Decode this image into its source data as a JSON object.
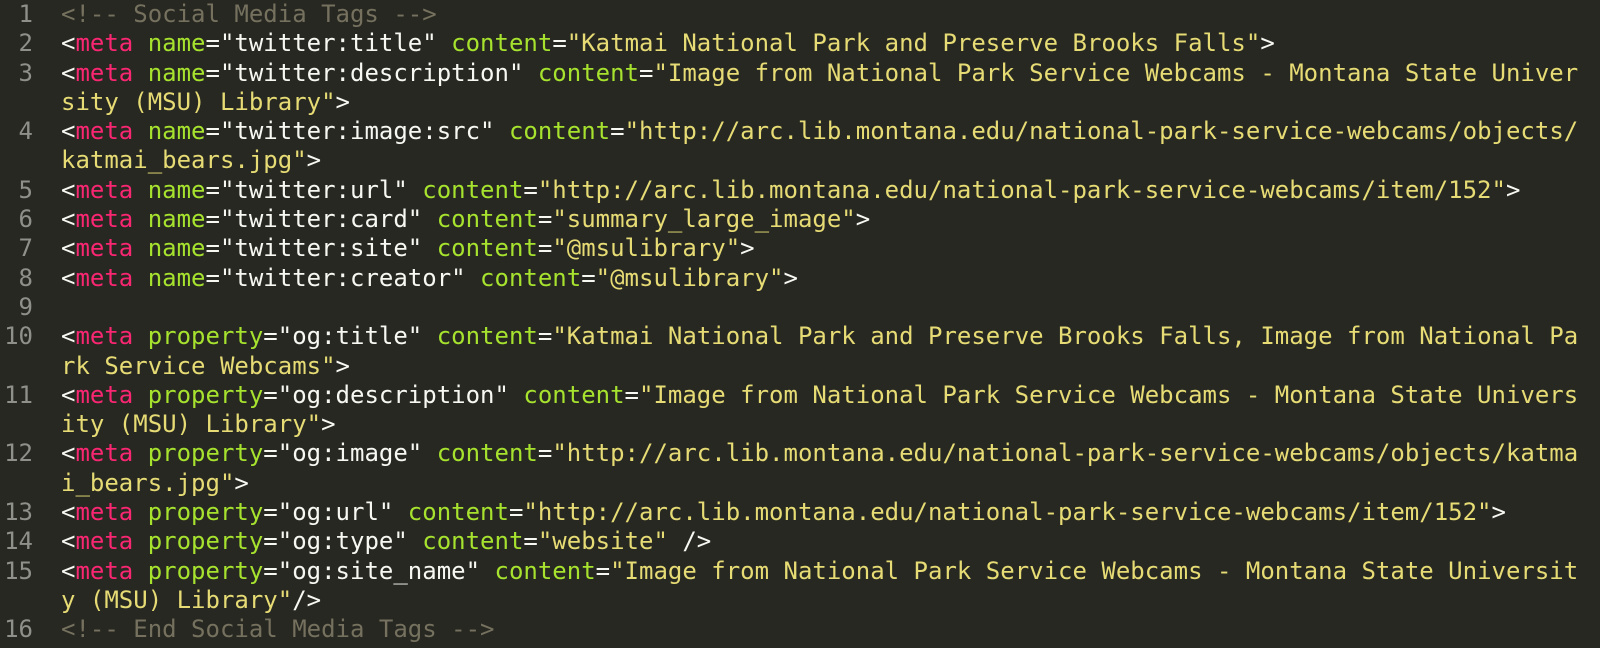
{
  "theme": {
    "background": "#272822",
    "text": "#f8f8f2",
    "gutter": "#90908a",
    "comment": "#75715e",
    "tag": "#f92672",
    "attribute": "#a6e22e",
    "string": "#e6db74"
  },
  "lines": [
    {
      "num": "1",
      "tokens": [
        {
          "t": "comment",
          "v": "<!-- Social Media Tags -->"
        }
      ]
    },
    {
      "num": "2",
      "tokens": [
        {
          "t": "punct",
          "v": "<"
        },
        {
          "t": "tag",
          "v": "meta"
        },
        {
          "t": "punct",
          "v": " "
        },
        {
          "t": "attr",
          "v": "name"
        },
        {
          "t": "punct",
          "v": "="
        },
        {
          "t": "punct",
          "v": "\"twitter:title\""
        },
        {
          "t": "punct",
          "v": " "
        },
        {
          "t": "attr",
          "v": "content"
        },
        {
          "t": "punct",
          "v": "="
        },
        {
          "t": "string",
          "v": "\"Katmai National Park and Preserve Brooks Falls\""
        },
        {
          "t": "punct",
          "v": ">"
        }
      ]
    },
    {
      "num": "3",
      "tokens": [
        {
          "t": "punct",
          "v": "<"
        },
        {
          "t": "tag",
          "v": "meta"
        },
        {
          "t": "punct",
          "v": " "
        },
        {
          "t": "attr",
          "v": "name"
        },
        {
          "t": "punct",
          "v": "="
        },
        {
          "t": "punct",
          "v": "\"twitter:description\""
        },
        {
          "t": "punct",
          "v": " "
        },
        {
          "t": "attr",
          "v": "content"
        },
        {
          "t": "punct",
          "v": "="
        },
        {
          "t": "string",
          "v": "\"Image from National Park Service Webcams - Montana State University (MSU) Library\""
        },
        {
          "t": "punct",
          "v": ">"
        }
      ]
    },
    {
      "num": "4",
      "tokens": [
        {
          "t": "punct",
          "v": "<"
        },
        {
          "t": "tag",
          "v": "meta"
        },
        {
          "t": "punct",
          "v": " "
        },
        {
          "t": "attr",
          "v": "name"
        },
        {
          "t": "punct",
          "v": "="
        },
        {
          "t": "punct",
          "v": "\"twitter:image:src\""
        },
        {
          "t": "punct",
          "v": " "
        },
        {
          "t": "attr",
          "v": "content"
        },
        {
          "t": "punct",
          "v": "="
        },
        {
          "t": "string",
          "v": "\"http://arc.lib.montana.edu/national-park-service-webcams/objects/katmai_bears.jpg\""
        },
        {
          "t": "punct",
          "v": ">"
        }
      ]
    },
    {
      "num": "5",
      "tokens": [
        {
          "t": "punct",
          "v": "<"
        },
        {
          "t": "tag",
          "v": "meta"
        },
        {
          "t": "punct",
          "v": " "
        },
        {
          "t": "attr",
          "v": "name"
        },
        {
          "t": "punct",
          "v": "="
        },
        {
          "t": "punct",
          "v": "\"twitter:url\""
        },
        {
          "t": "punct",
          "v": " "
        },
        {
          "t": "attr",
          "v": "content"
        },
        {
          "t": "punct",
          "v": "="
        },
        {
          "t": "string",
          "v": "\"http://arc.lib.montana.edu/national-park-service-webcams/item/152\""
        },
        {
          "t": "punct",
          "v": ">"
        }
      ]
    },
    {
      "num": "6",
      "tokens": [
        {
          "t": "punct",
          "v": "<"
        },
        {
          "t": "tag",
          "v": "meta"
        },
        {
          "t": "punct",
          "v": " "
        },
        {
          "t": "attr",
          "v": "name"
        },
        {
          "t": "punct",
          "v": "="
        },
        {
          "t": "punct",
          "v": "\"twitter:card\""
        },
        {
          "t": "punct",
          "v": " "
        },
        {
          "t": "attr",
          "v": "content"
        },
        {
          "t": "punct",
          "v": "="
        },
        {
          "t": "string",
          "v": "\"summary_large_image\""
        },
        {
          "t": "punct",
          "v": ">"
        }
      ]
    },
    {
      "num": "7",
      "tokens": [
        {
          "t": "punct",
          "v": "<"
        },
        {
          "t": "tag",
          "v": "meta"
        },
        {
          "t": "punct",
          "v": " "
        },
        {
          "t": "attr",
          "v": "name"
        },
        {
          "t": "punct",
          "v": "="
        },
        {
          "t": "punct",
          "v": "\"twitter:site\""
        },
        {
          "t": "punct",
          "v": " "
        },
        {
          "t": "attr",
          "v": "content"
        },
        {
          "t": "punct",
          "v": "="
        },
        {
          "t": "string",
          "v": "\"@msulibrary\""
        },
        {
          "t": "punct",
          "v": ">"
        }
      ]
    },
    {
      "num": "8",
      "tokens": [
        {
          "t": "punct",
          "v": "<"
        },
        {
          "t": "tag",
          "v": "meta"
        },
        {
          "t": "punct",
          "v": " "
        },
        {
          "t": "attr",
          "v": "name"
        },
        {
          "t": "punct",
          "v": "="
        },
        {
          "t": "punct",
          "v": "\"twitter:creator\""
        },
        {
          "t": "punct",
          "v": " "
        },
        {
          "t": "attr",
          "v": "content"
        },
        {
          "t": "punct",
          "v": "="
        },
        {
          "t": "string",
          "v": "\"@msulibrary\""
        },
        {
          "t": "punct",
          "v": ">"
        }
      ]
    },
    {
      "num": "9",
      "tokens": []
    },
    {
      "num": "10",
      "tokens": [
        {
          "t": "punct",
          "v": "<"
        },
        {
          "t": "tag",
          "v": "meta"
        },
        {
          "t": "punct",
          "v": " "
        },
        {
          "t": "attr",
          "v": "property"
        },
        {
          "t": "punct",
          "v": "="
        },
        {
          "t": "punct",
          "v": "\"og:title\""
        },
        {
          "t": "punct",
          "v": " "
        },
        {
          "t": "attr",
          "v": "content"
        },
        {
          "t": "punct",
          "v": "="
        },
        {
          "t": "string",
          "v": "\"Katmai National Park and Preserve Brooks Falls, Image from National Park Service Webcams\""
        },
        {
          "t": "punct",
          "v": ">"
        }
      ]
    },
    {
      "num": "11",
      "tokens": [
        {
          "t": "punct",
          "v": "<"
        },
        {
          "t": "tag",
          "v": "meta"
        },
        {
          "t": "punct",
          "v": " "
        },
        {
          "t": "attr",
          "v": "property"
        },
        {
          "t": "punct",
          "v": "="
        },
        {
          "t": "punct",
          "v": "\"og:description\""
        },
        {
          "t": "punct",
          "v": " "
        },
        {
          "t": "attr",
          "v": "content"
        },
        {
          "t": "punct",
          "v": "="
        },
        {
          "t": "string",
          "v": "\"Image from National Park Service Webcams - Montana State University (MSU) Library\""
        },
        {
          "t": "punct",
          "v": ">"
        }
      ]
    },
    {
      "num": "12",
      "tokens": [
        {
          "t": "punct",
          "v": "<"
        },
        {
          "t": "tag",
          "v": "meta"
        },
        {
          "t": "punct",
          "v": " "
        },
        {
          "t": "attr",
          "v": "property"
        },
        {
          "t": "punct",
          "v": "="
        },
        {
          "t": "punct",
          "v": "\"og:image\""
        },
        {
          "t": "punct",
          "v": " "
        },
        {
          "t": "attr",
          "v": "content"
        },
        {
          "t": "punct",
          "v": "="
        },
        {
          "t": "string",
          "v": "\"http://arc.lib.montana.edu/national-park-service-webcams/objects/katmai_bears.jpg\""
        },
        {
          "t": "punct",
          "v": ">"
        }
      ]
    },
    {
      "num": "13",
      "tokens": [
        {
          "t": "punct",
          "v": "<"
        },
        {
          "t": "tag",
          "v": "meta"
        },
        {
          "t": "punct",
          "v": " "
        },
        {
          "t": "attr",
          "v": "property"
        },
        {
          "t": "punct",
          "v": "="
        },
        {
          "t": "punct",
          "v": "\"og:url\""
        },
        {
          "t": "punct",
          "v": " "
        },
        {
          "t": "attr",
          "v": "content"
        },
        {
          "t": "punct",
          "v": "="
        },
        {
          "t": "string",
          "v": "\"http://arc.lib.montana.edu/national-park-service-webcams/item/152\""
        },
        {
          "t": "punct",
          "v": ">"
        }
      ]
    },
    {
      "num": "14",
      "tokens": [
        {
          "t": "punct",
          "v": "<"
        },
        {
          "t": "tag",
          "v": "meta"
        },
        {
          "t": "punct",
          "v": " "
        },
        {
          "t": "attr",
          "v": "property"
        },
        {
          "t": "punct",
          "v": "="
        },
        {
          "t": "punct",
          "v": "\"og:type\""
        },
        {
          "t": "punct",
          "v": " "
        },
        {
          "t": "attr",
          "v": "content"
        },
        {
          "t": "punct",
          "v": "="
        },
        {
          "t": "string",
          "v": "\"website\""
        },
        {
          "t": "punct",
          "v": " />"
        }
      ]
    },
    {
      "num": "15",
      "tokens": [
        {
          "t": "punct",
          "v": "<"
        },
        {
          "t": "tag",
          "v": "meta"
        },
        {
          "t": "punct",
          "v": " "
        },
        {
          "t": "attr",
          "v": "property"
        },
        {
          "t": "punct",
          "v": "="
        },
        {
          "t": "punct",
          "v": "\"og:site_name\""
        },
        {
          "t": "punct",
          "v": " "
        },
        {
          "t": "attr",
          "v": "content"
        },
        {
          "t": "punct",
          "v": "="
        },
        {
          "t": "string",
          "v": "\"Image from National Park Service Webcams - Montana State University (MSU) Library\""
        },
        {
          "t": "punct",
          "v": "/>"
        }
      ]
    },
    {
      "num": "16",
      "tokens": [
        {
          "t": "comment",
          "v": "<!-- End Social Media Tags -->"
        }
      ]
    }
  ]
}
